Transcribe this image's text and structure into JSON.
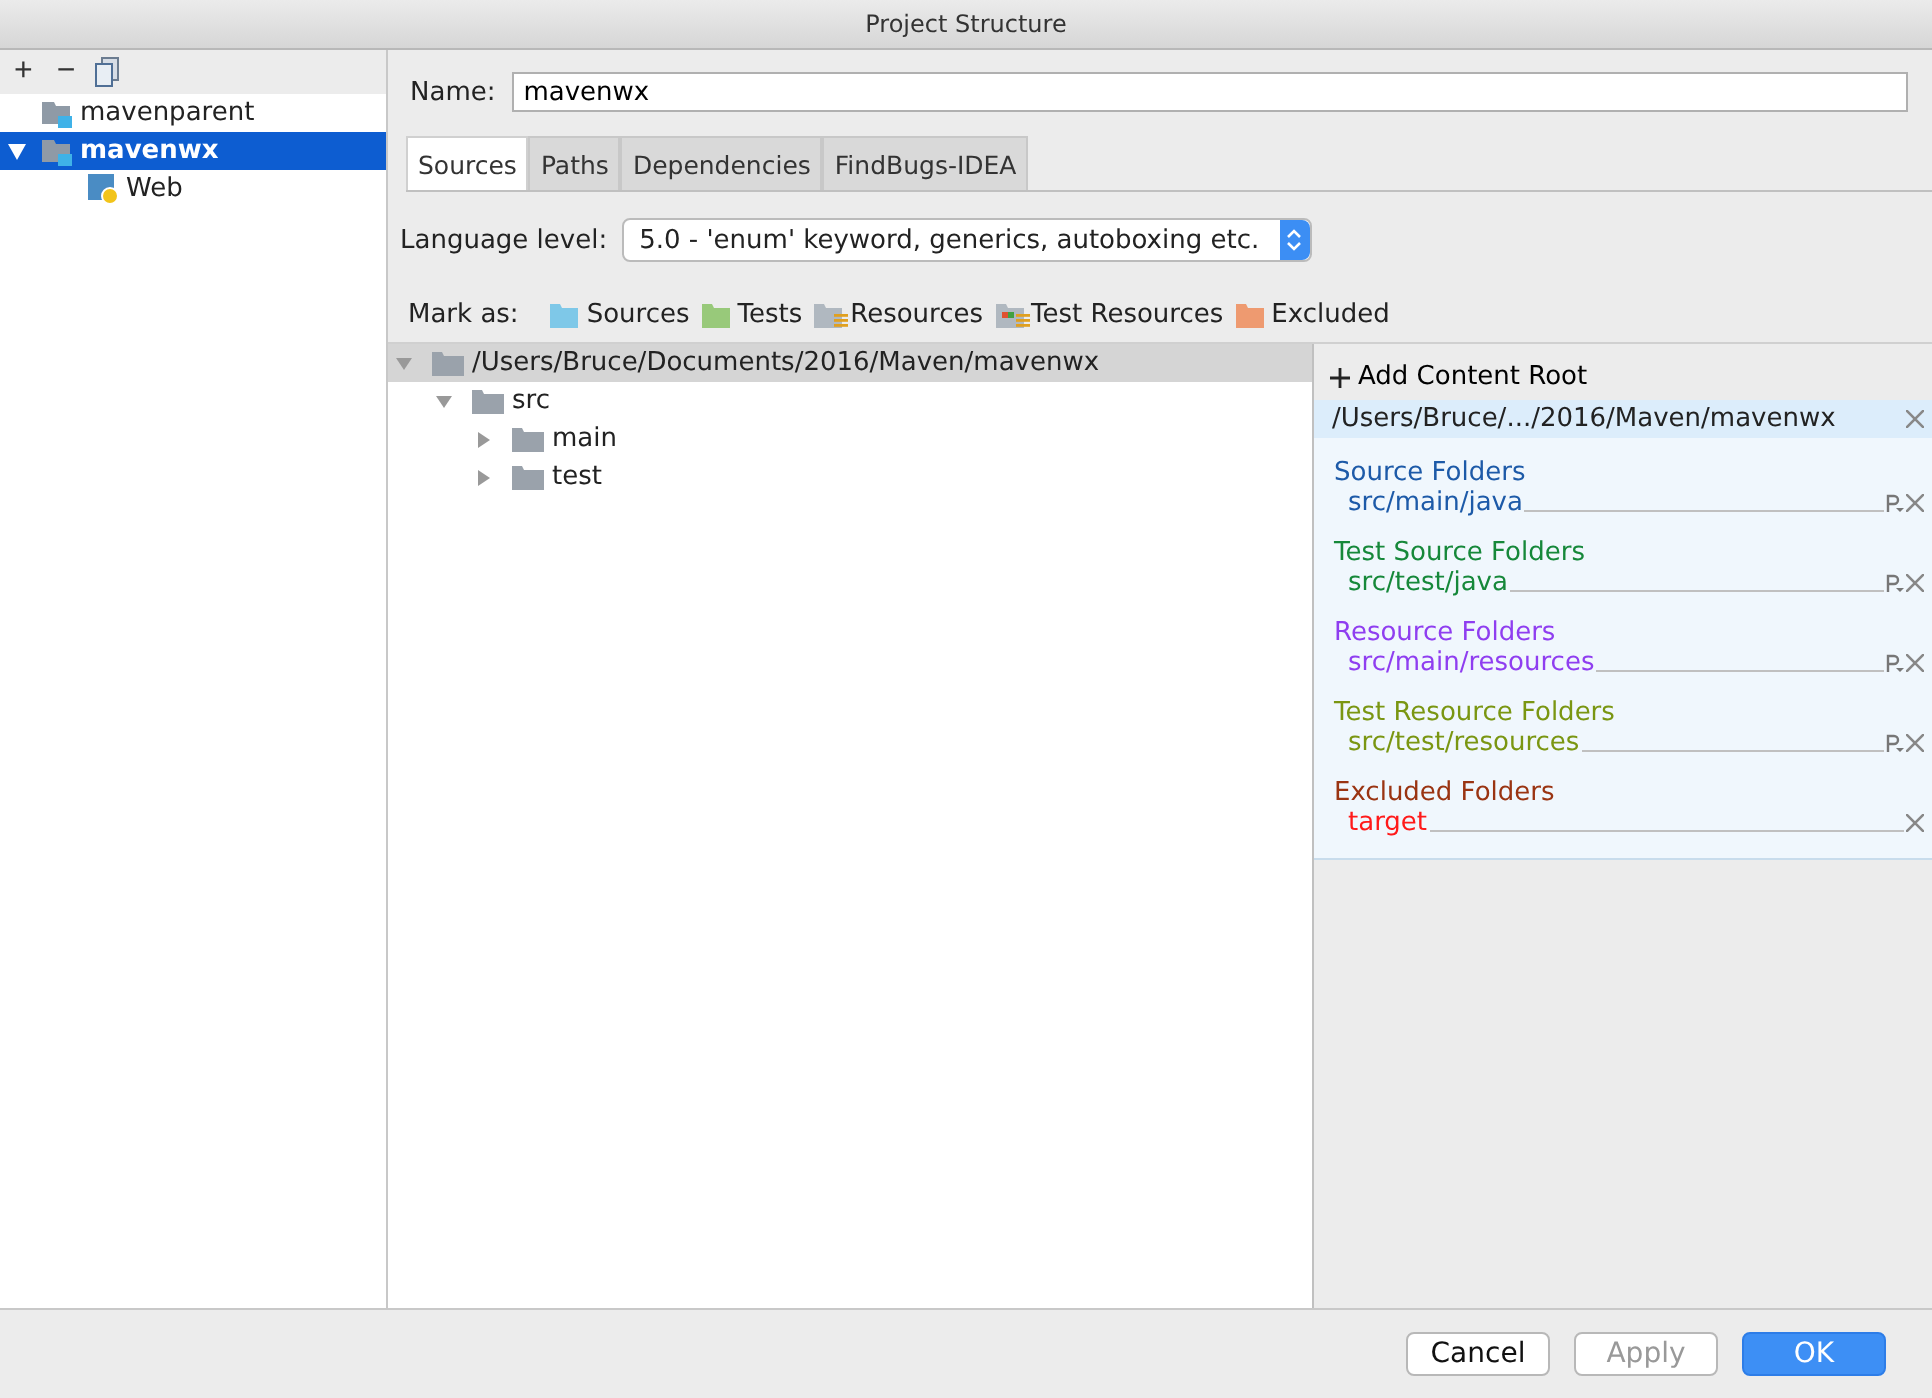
{
  "window": {
    "title": "Project Structure"
  },
  "sidebar": {
    "toolbar": [
      "+",
      "−"
    ],
    "items": [
      {
        "label": "mavenparent",
        "selected": false,
        "kind": "module"
      },
      {
        "label": "mavenwx",
        "selected": true,
        "expanded": true,
        "kind": "module",
        "children": [
          {
            "label": "Web",
            "selected": false,
            "kind": "web"
          }
        ]
      }
    ]
  },
  "name_field": {
    "label": "Name:",
    "value": "mavenwx"
  },
  "tabs": [
    {
      "label": "Sources",
      "selected": true
    },
    {
      "label": "Paths",
      "selected": false
    },
    {
      "label": "Dependencies",
      "selected": false
    },
    {
      "label": "FindBugs-IDEA",
      "selected": false
    }
  ],
  "language_level": {
    "label": "Language level:",
    "value": "5.0 - 'enum' keyword, generics, autoboxing etc."
  },
  "mark_as": {
    "label": "Mark as:",
    "items": [
      {
        "label": "Sources",
        "color": "#7ec8e8",
        "kind": "plain"
      },
      {
        "label": "Tests",
        "color": "#98c97a",
        "kind": "plain"
      },
      {
        "label": "Resources",
        "color": "#b0b8c0",
        "kind": "resource"
      },
      {
        "label": "Test Resources",
        "color": "#b0b8c0",
        "kind": "test-resource"
      },
      {
        "label": "Excluded",
        "color": "#ee9a70",
        "kind": "plain"
      }
    ]
  },
  "tree": {
    "root": {
      "label": "/Users/Bruce/Documents/2016/Maven/mavenwx",
      "expanded": true,
      "children": [
        {
          "label": "src",
          "expanded": true,
          "children": [
            {
              "label": "main",
              "expanded": false
            },
            {
              "label": "test",
              "expanded": false
            }
          ]
        }
      ]
    }
  },
  "content_root": {
    "add_label": "Add Content Root",
    "path": "/Users/Bruce/.../2016/Maven/mavenwx",
    "groups": [
      {
        "title": "Source Folders",
        "color": "#1d5aa8",
        "folders": [
          {
            "path": "src/main/java",
            "color": "#1d5aa8",
            "properties": true
          }
        ]
      },
      {
        "title": "Test Source Folders",
        "color": "#16883a",
        "folders": [
          {
            "path": "src/test/java",
            "color": "#16883a",
            "properties": true
          }
        ]
      },
      {
        "title": "Resource Folders",
        "color": "#8f3ef0",
        "folders": [
          {
            "path": "src/main/resources",
            "color": "#8f3ef0",
            "properties": true
          }
        ]
      },
      {
        "title": "Test Resource Folders",
        "color": "#7a9612",
        "folders": [
          {
            "path": "src/test/resources",
            "color": "#7a9612",
            "properties": true
          }
        ]
      },
      {
        "title": "Excluded Folders",
        "color": "#9a3412",
        "folders": [
          {
            "path": "target",
            "color": "#ff1a1a",
            "properties": false
          }
        ]
      }
    ]
  },
  "buttons": [
    {
      "label": "Cancel",
      "kind": "normal",
      "disabled": false
    },
    {
      "label": "Apply",
      "kind": "normal",
      "disabled": true
    },
    {
      "label": "OK",
      "kind": "default",
      "disabled": false
    }
  ]
}
